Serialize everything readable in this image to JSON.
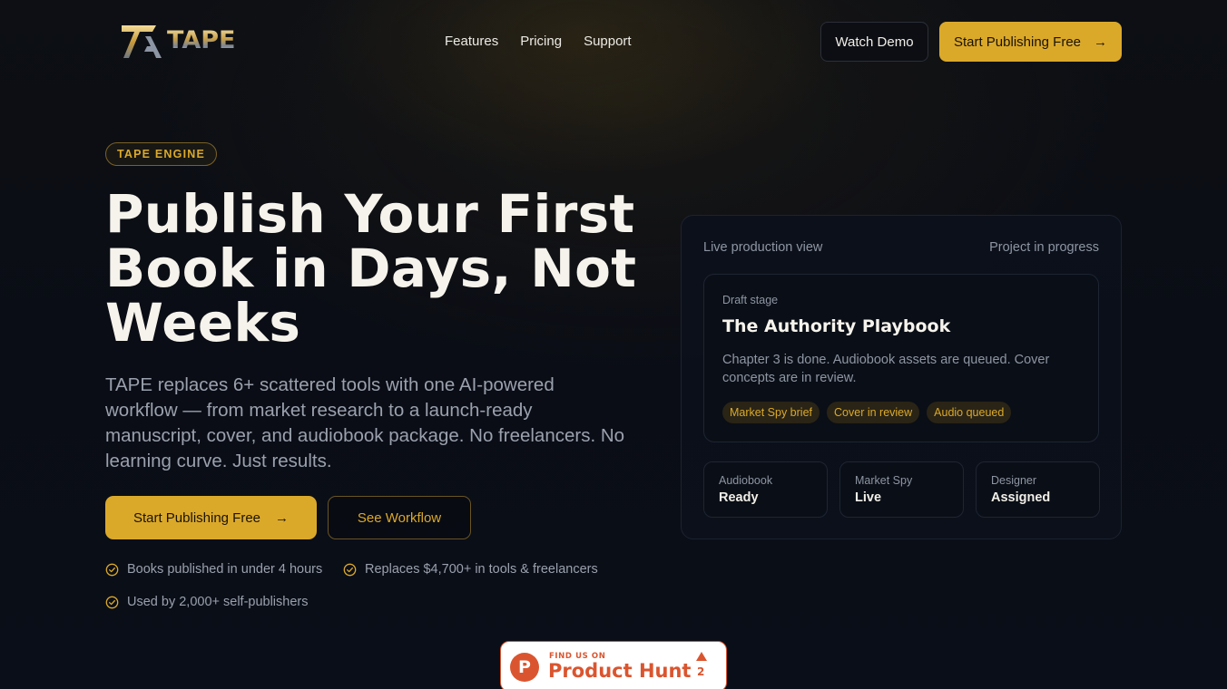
{
  "nav": {
    "logo_text": "TAPE",
    "links": [
      "Features",
      "Pricing",
      "Support"
    ],
    "watch_demo": "Watch Demo",
    "start_publishing": "Start Publishing Free",
    "arrow": "→"
  },
  "hero": {
    "badge": "TAPE ENGINE",
    "title": "Publish Your First Book in Days, Not Weeks",
    "subtitle": "TAPE replaces 6+ scattered tools with one AI-powered workflow — from market research to a launch-ready manuscript, cover, and audiobook package. No freelancers. No learning curve. Just results.",
    "cta_primary": "Start Publishing Free",
    "cta_arrow": "→",
    "cta_secondary": "See Workflow",
    "features": [
      "Books published in under 4 hours",
      "Replaces $4,700+ in tools & freelancers",
      "Used by 2,000+ self-publishers"
    ]
  },
  "card": {
    "header_left": "Live production view",
    "header_right": "Project in progress",
    "stage": "Draft stage",
    "book_title": "The Authority Playbook",
    "description": "Chapter 3 is done. Audiobook assets are queued. Cover concepts are in review.",
    "tags": [
      "Market Spy brief",
      "Cover in review",
      "Audio queued"
    ],
    "stats": [
      {
        "label": "Audiobook",
        "value": "Ready"
      },
      {
        "label": "Market Spy",
        "value": "Live"
      },
      {
        "label": "Designer",
        "value": "Assigned"
      }
    ]
  },
  "product_hunt": {
    "letter": "P",
    "small_text": "FIND US ON",
    "big_text": "Product Hunt",
    "count": "2"
  },
  "colors": {
    "accent": "#dba92a",
    "background": "#0a0d15",
    "product_hunt": "#da552f"
  },
  "icons": {
    "logo": "tape-logo-icon",
    "arrow": "arrow-right-icon",
    "check": "check-circle-icon",
    "upvote": "upvote-triangle-icon"
  }
}
